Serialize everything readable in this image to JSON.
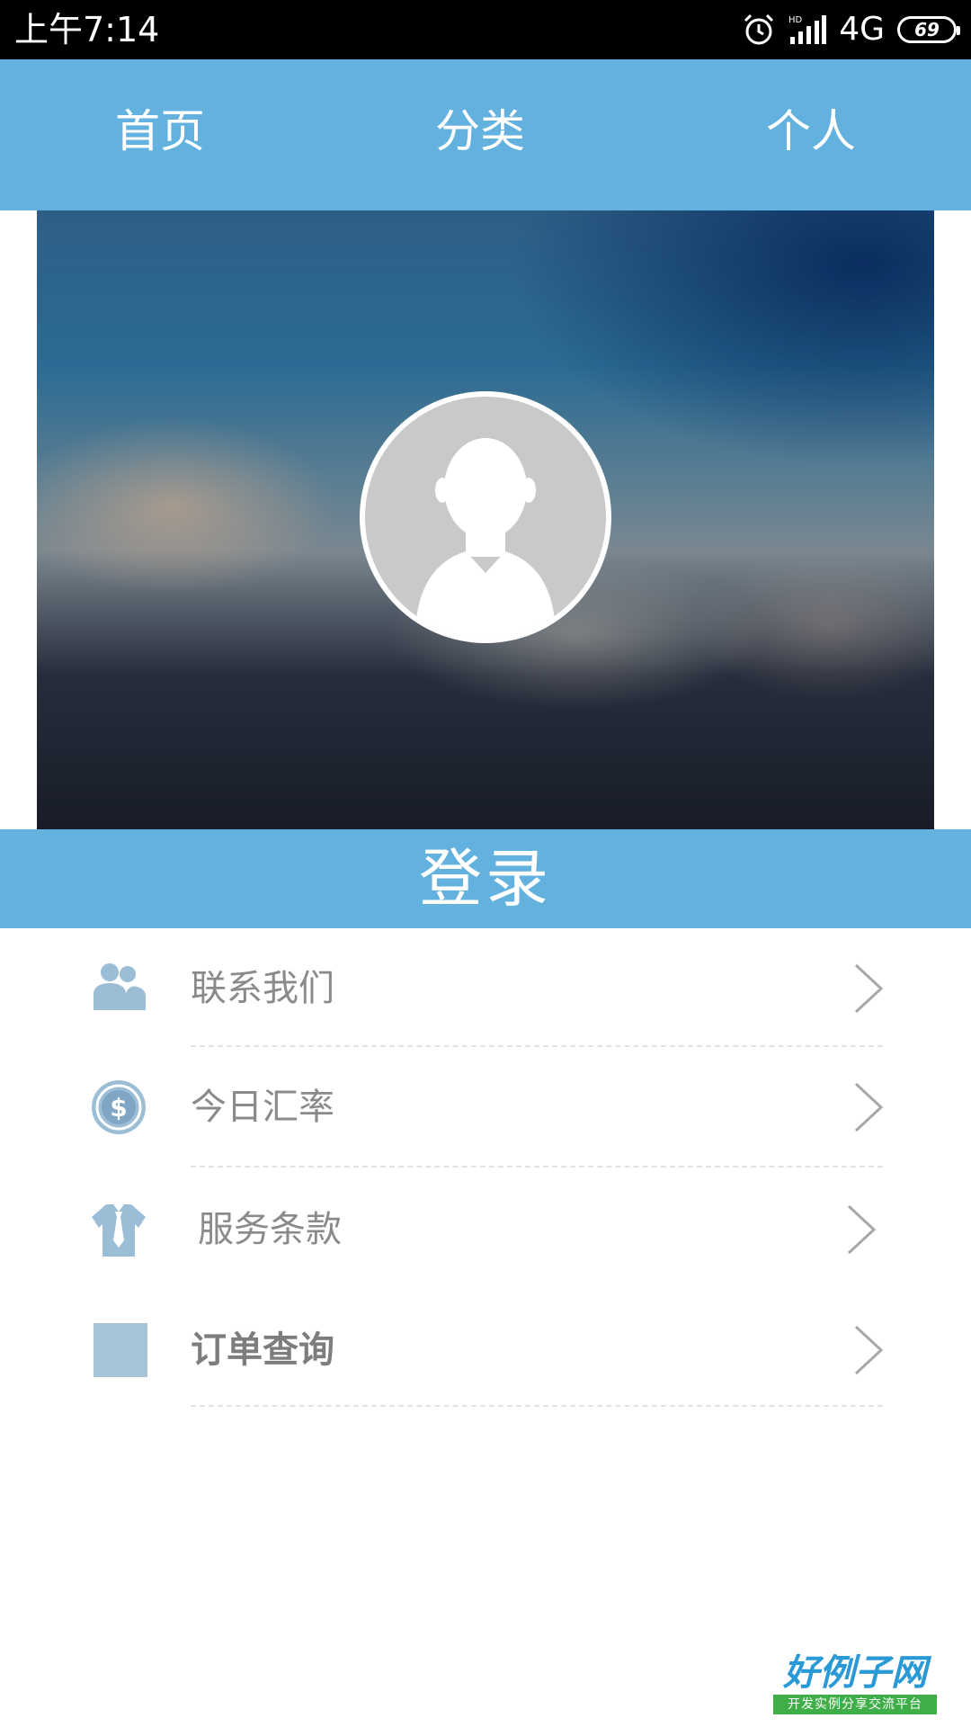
{
  "status_bar": {
    "time": "上午7:14",
    "network": "4G",
    "battery": "69"
  },
  "nav": {
    "tabs": [
      {
        "label": "首页"
      },
      {
        "label": "分类"
      },
      {
        "label": "个人"
      }
    ]
  },
  "profile": {
    "login_label": "登录"
  },
  "menu": {
    "items": [
      {
        "label": "联系我们",
        "icon": "people-icon"
      },
      {
        "label": "今日汇率",
        "icon": "dollar-coin-icon"
      },
      {
        "label": "服务条款",
        "icon": "shirt-tie-icon"
      },
      {
        "label": "订单查询",
        "icon": "square-icon"
      }
    ]
  },
  "watermark": {
    "logo_title": "好例子网",
    "logo_subtitle": "开发实例分享交流平台"
  },
  "colors": {
    "accent": "#62b1de",
    "icon": "#9bbdd6",
    "menu_text": "#8a8a8a",
    "status_bar": "#000000"
  }
}
